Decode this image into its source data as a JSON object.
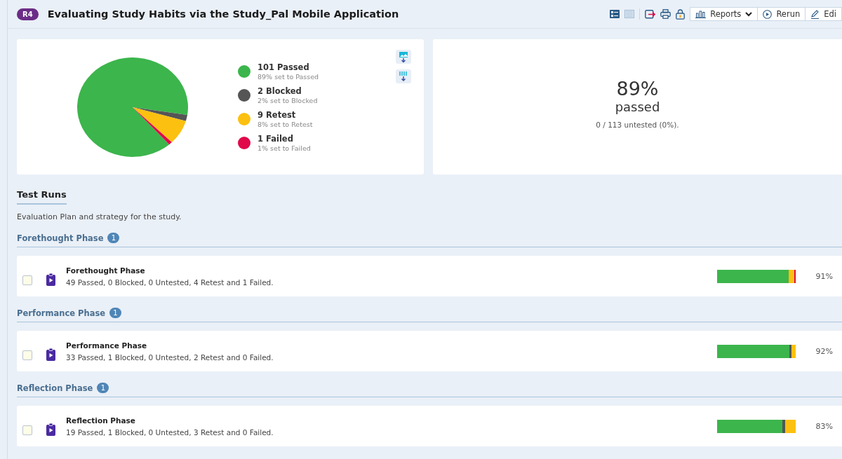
{
  "header": {
    "badge": "R4",
    "title": "Evaluating Study Habits via the Study_Pal Mobile Application",
    "view_toggles": [
      {
        "selected": true
      },
      {
        "selected": false
      }
    ],
    "buttons": [
      {
        "label": "Reports"
      },
      {
        "label": "Rerun"
      },
      {
        "label": "Edi"
      }
    ]
  },
  "summary": {
    "chart_data": {
      "type": "pie",
      "values": [
        89,
        2,
        8,
        1
      ]
    },
    "legend": [
      {
        "title": "101 Passed",
        "subtitle": "89% set to Passed",
        "color": "#3cb54c"
      },
      {
        "title": "2 Blocked",
        "subtitle": "2% set to Blocked",
        "color": "#555555"
      },
      {
        "title": "9 Retest",
        "subtitle": "8% set to Retest",
        "color": "#fcc010"
      },
      {
        "title": "1 Failed",
        "subtitle": "1% set to Failed",
        "color": "#e0094a"
      }
    ],
    "percent": "89%",
    "percent_label": "passed",
    "untested": "0 / 113 untested (0%)."
  },
  "test_runs": {
    "title": "Test Runs",
    "description": "Evaluation Plan and strategy for the study.",
    "groups": [
      {
        "name": "Forethought Phase",
        "count": "1",
        "runs": [
          {
            "name": "Forethought Phase",
            "stats": "49 Passed, 0 Blocked, 0 Untested, 4 Retest and 1 Failed.",
            "checked": false,
            "percent": "91%"
          }
        ]
      },
      {
        "name": "Performance Phase",
        "count": "1",
        "runs": [
          {
            "name": "Performance Phase",
            "stats": "33 Passed, 1 Blocked, 0 Untested, 2 Retest and 0 Failed.",
            "checked": false,
            "percent": "92%"
          }
        ]
      },
      {
        "name": "Reflection Phase",
        "count": "1",
        "runs": [
          {
            "name": "Reflection Phase",
            "stats": "19 Passed, 1 Blocked, 0 Untested, 3 Retest and 0 Failed.",
            "checked": false,
            "percent": "83%"
          }
        ]
      }
    ]
  }
}
